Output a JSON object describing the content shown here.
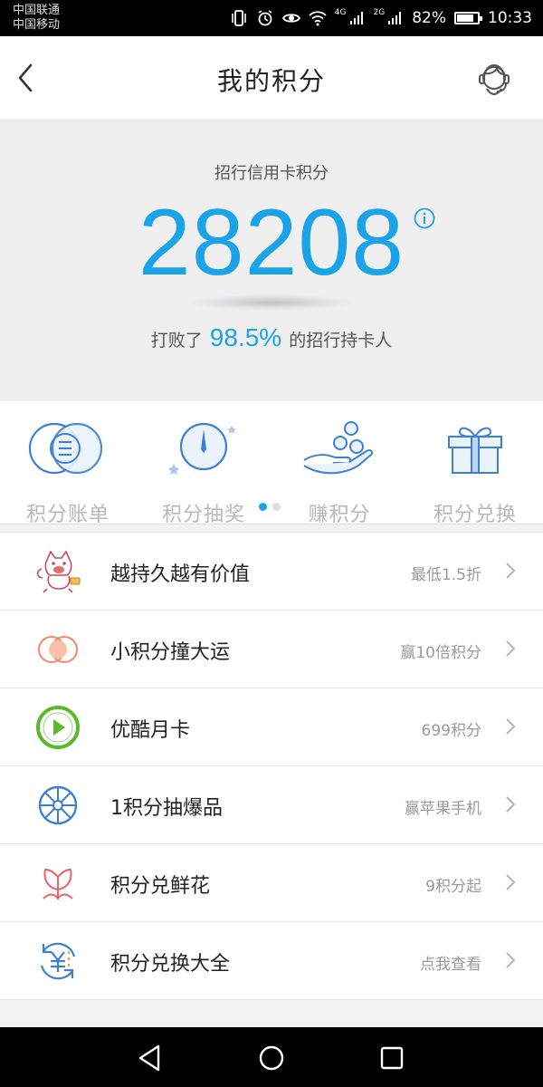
{
  "status_bar": {
    "carrier1": "中国联通",
    "carrier2": "中国移动",
    "net1": "4G",
    "net2": "2G",
    "battery": "82%",
    "time": "10:33"
  },
  "header": {
    "title": "我的积分"
  },
  "hero": {
    "label": "招行信用卡积分",
    "points": "28208",
    "beat_prefix": "打败了",
    "beat_percent": "98.5%",
    "beat_suffix": "的招行持卡人"
  },
  "quick_actions": [
    {
      "label": "积分账单",
      "icon": "bill-icon"
    },
    {
      "label": "积分抽奖",
      "icon": "lottery-dial-icon"
    },
    {
      "label": "赚积分",
      "icon": "earn-coins-icon"
    },
    {
      "label": "积分兑换",
      "icon": "gift-box-icon"
    }
  ],
  "pager": {
    "pages": 2,
    "active": 0
  },
  "list": [
    {
      "title": "越持久越有价值",
      "sub": "最低1.5折",
      "icon": "cat-mascot-icon"
    },
    {
      "title": "小积分撞大运",
      "sub": "赢10倍积分",
      "icon": "overlap-circles-icon"
    },
    {
      "title": "优酷月卡",
      "sub": "699积分",
      "icon": "play-icon"
    },
    {
      "title": "1积分抽爆品",
      "sub": "赢苹果手机",
      "icon": "wheel-icon"
    },
    {
      "title": "积分兑鲜花",
      "sub": "9积分起",
      "icon": "flower-icon"
    },
    {
      "title": "积分兑换大全",
      "sub": "点我查看",
      "icon": "yuan-exchange-icon"
    }
  ],
  "colors": {
    "accent": "#1aa3e8",
    "play_green": "#5cb82c",
    "coral": "#f08a6a",
    "flower_red": "#e8646a",
    "wheel_blue": "#3e7fd6"
  }
}
